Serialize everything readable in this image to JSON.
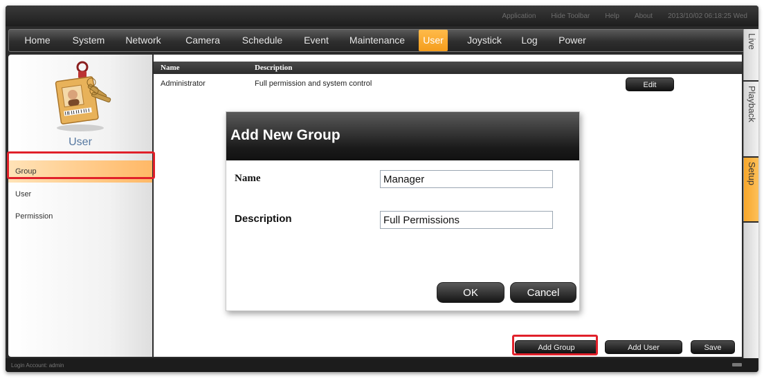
{
  "topbar": {
    "links": [
      "Application",
      "Hide Toolbar",
      "Help",
      "About"
    ],
    "datetime": "2013/10/02 06:18:25 Wed"
  },
  "nav": {
    "items": [
      "Home",
      "System",
      "Network",
      "Camera",
      "Schedule",
      "Event",
      "Maintenance",
      "User",
      "Joystick",
      "Log",
      "Power"
    ],
    "active": "User"
  },
  "side_tabs": [
    "Live",
    "Playback",
    "Setup"
  ],
  "left": {
    "title": "User",
    "menu": [
      "Group",
      "User",
      "Permission"
    ],
    "active_menu": "Group"
  },
  "table": {
    "headers": [
      "Name",
      "Description"
    ],
    "rows": [
      {
        "name": "Administrator",
        "description": "Full permission and system control",
        "action": "Edit"
      }
    ]
  },
  "dialog": {
    "title": "Add New Group",
    "name_label": "Name",
    "name_value": "Manager",
    "description_label": "Description",
    "description_value": "Full Permissions",
    "ok": "OK",
    "cancel": "Cancel"
  },
  "actions": {
    "add_group": "Add Group",
    "add_user": "Add User",
    "save": "Save"
  },
  "status": {
    "login": "Login Account: admin"
  },
  "colors": {
    "accent": "#f7a62a",
    "highlight_border": "#e0202a"
  }
}
